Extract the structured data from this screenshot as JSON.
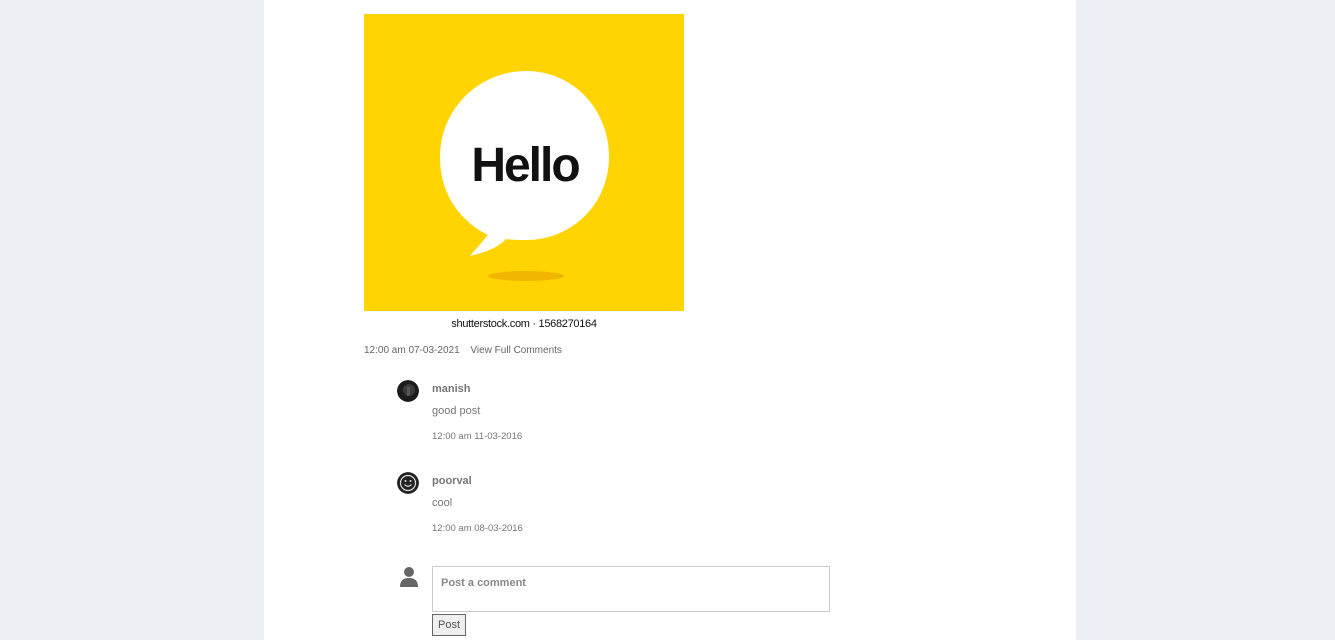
{
  "post": {
    "image": {
      "alt": "Hello speech bubble",
      "text": "Hello",
      "watermark": "shutterstock.com · 1568270164",
      "background_color": "#ffd400"
    },
    "timestamp": "12:00 am 07-03-2021",
    "view_comments_label": "View Full Comments"
  },
  "comments": [
    {
      "author": "manish",
      "text": "good post",
      "timestamp": "12:00 am 11-03-2016",
      "avatar_icon": "dark-photo-avatar"
    },
    {
      "author": "poorval",
      "text": "cool",
      "timestamp": "12:00 am 08-03-2016",
      "avatar_icon": "smiley-avatar"
    }
  ],
  "new_comment": {
    "placeholder": "Post a comment",
    "button_label": "Post",
    "user_icon": "user-silhouette-icon"
  }
}
